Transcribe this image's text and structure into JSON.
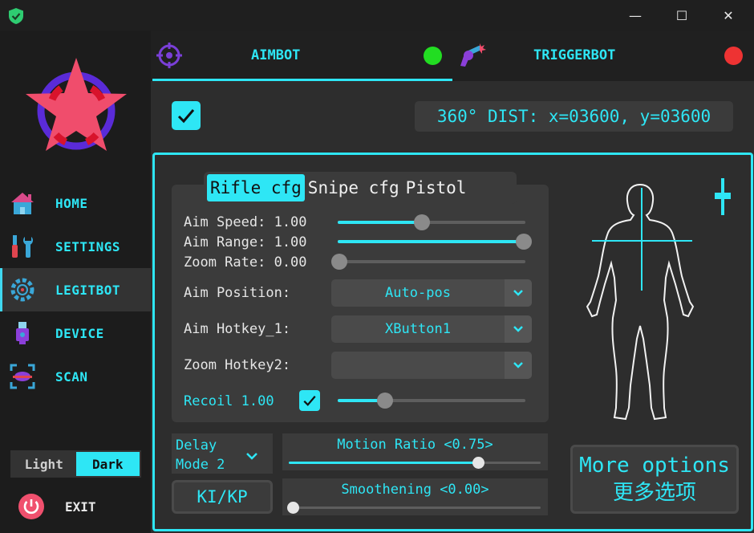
{
  "window": {
    "minimize_glyph": "—",
    "maximize_glyph": "☐",
    "close_glyph": "✕"
  },
  "sidebar": {
    "items": [
      {
        "label": "HOME",
        "icon": "home-icon"
      },
      {
        "label": "SETTINGS",
        "icon": "tools-icon"
      },
      {
        "label": "LEGITBOT",
        "icon": "gear-crosshair-icon",
        "active": true
      },
      {
        "label": "DEVICE",
        "icon": "usb-icon"
      },
      {
        "label": "SCAN",
        "icon": "scan-icon"
      }
    ],
    "theme": {
      "light": "Light",
      "dark": "Dark",
      "selected": "Dark"
    },
    "exit_label": "EXIT"
  },
  "tabs": {
    "aimbot": {
      "label": "AIMBOT",
      "status_color": "#22dd22"
    },
    "triggerbot": {
      "label": "TRIGGERBOT",
      "status_color": "#ee3333"
    }
  },
  "aimbot": {
    "enabled": true,
    "dist_readout": "360° DIST: x=03600, y=03600",
    "cfg_tabs": [
      "Rifle cfg",
      "Snipe cfg",
      "Pistol"
    ],
    "active_cfg": "Rifle cfg",
    "sliders": {
      "aim_speed": {
        "label": "Aim Speed: 1.00",
        "fraction": 0.45
      },
      "aim_range": {
        "label": "Aim Range: 1.00",
        "fraction": 1.0
      },
      "zoom_rate": {
        "label": "Zoom Rate: 0.00",
        "fraction": 0.0
      }
    },
    "aim_position": {
      "label": "Aim Position:",
      "value": "Auto-pos"
    },
    "aim_hotkey_1": {
      "label": "Aim Hotkey_1:",
      "value": "XButton1"
    },
    "zoom_hotkey_2": {
      "label": "Zoom Hotkey2:",
      "value": ""
    },
    "recoil": {
      "label": "Recoil 1.00",
      "checked": true,
      "fraction": 0.25
    },
    "delay_mode": {
      "line1": "Delay",
      "line2": "Mode 2"
    },
    "motion_ratio": {
      "label": "Motion Ratio <0.75>",
      "fraction": 0.75
    },
    "smoothening": {
      "label": "Smoothening <0.00>",
      "fraction": 0.0
    },
    "kikp_label": "KI/KP",
    "more_options": {
      "line1": "More options",
      "line2": "更多选项"
    }
  },
  "colors": {
    "accent": "#2ee6f5",
    "logo_star": "#f04d6c",
    "logo_ring": "#5a2bd8",
    "exit_icon": "#f0506e"
  }
}
